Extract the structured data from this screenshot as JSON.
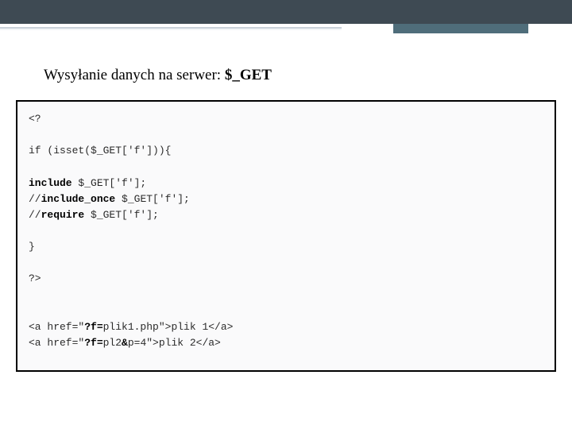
{
  "title": {
    "plain": "Wysyłanie danych na serwer: ",
    "bold": "$_GET"
  },
  "code": {
    "l1": "<?",
    "l2": "",
    "l3": "if (isset($_GET['f'])){",
    "l4": "",
    "l5a": "include",
    "l5b": " $_GET['f'];",
    "l6a": "//",
    "l6b": "include_once",
    "l6c": " $_GET['f'];",
    "l7a": "//",
    "l7b": "require",
    "l7c": " $_GET['f'];",
    "l8": "",
    "l9": "}",
    "l10": "",
    "l11": "?>",
    "l12": "",
    "l13": "",
    "l14a": "<a href=\"",
    "l14b": "?f=",
    "l14c": "plik1.php\">plik 1</a>",
    "l15a": "<a href=\"",
    "l15b": "?f=",
    "l15c": "pl2",
    "l15d": "&",
    "l15e": "p=4\">plik 2</a>"
  }
}
